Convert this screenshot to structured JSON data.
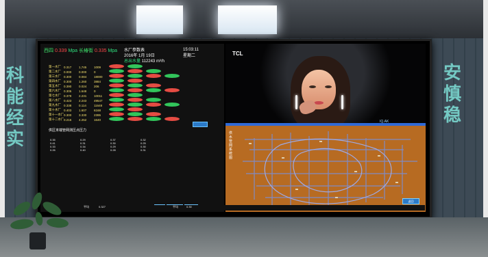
{
  "scene": {
    "wall_text_left": "科\n能\n经\n实",
    "wall_text_right": "安\n慎\n稳",
    "display": {
      "top_left": {
        "station_a": "西四",
        "value_a": "0.339",
        "unit_a": "Mpa",
        "station_b": "长椿街",
        "value_b": "0.335",
        "unit_b": "Mpa"
      },
      "header": {
        "company": "水厂参数表",
        "date": "2016年 1月 19日",
        "weekday": "星期二",
        "time": "15:03:11",
        "water_label": "总出水量",
        "water_value": "112243",
        "water_unit": "m³/h"
      },
      "table_rows": [
        [
          "第一水厂",
          "0.317",
          "1,745",
          "1009"
        ],
        [
          "第二水厂",
          "0.000",
          "0.000",
          "0"
        ],
        [
          "第三水厂",
          "0.300",
          "0.084",
          "18000"
        ],
        [
          "第四水厂",
          "0.300",
          "1.260",
          "3884"
        ],
        [
          "第五水厂",
          "0.390",
          "0.024",
          "206"
        ],
        [
          "第六水厂",
          "0.305",
          "1.648",
          "0"
        ],
        [
          "第七水厂",
          "0.379",
          "2.231",
          "10011"
        ],
        [
          "第八水厂",
          "0.423",
          "2.243",
          "49547"
        ],
        [
          "第九水厂",
          "0.338",
          "0.114",
          "11648"
        ],
        [
          "第十水厂",
          "0.403",
          "1.607",
          "6168"
        ],
        [
          "第十一水厂",
          "0.300",
          "3.330",
          "2395"
        ],
        [
          "第十二水厂",
          "0.216",
          "4.252",
          "1640"
        ]
      ],
      "lower_section_title": "供区末端管网测压点压力",
      "lower_values": [
        [
          "0.35",
          "0.41",
          "0.33",
          "0.26"
        ],
        [
          "0.29",
          "0.31",
          "0.34",
          "0.40"
        ],
        [
          "0.37",
          "0.30",
          "0.29",
          "0.28"
        ],
        [
          "0.32",
          "0.25",
          "0.30",
          "0.31"
        ]
      ],
      "bottom_text": {
        "left_label": "平均",
        "left_value": "0.327",
        "mid_label": "平均",
        "mid_value": "0.30"
      },
      "ad": {
        "brand": "TCL",
        "caption": "IQ.AK"
      },
      "map": {
        "title": "供水管网系统图",
        "button_label": "返回"
      }
    }
  }
}
